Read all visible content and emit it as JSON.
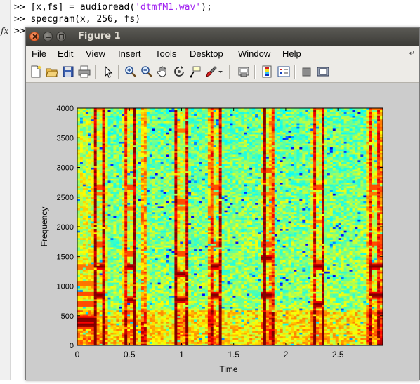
{
  "console": {
    "prompt": ">>",
    "line1": {
      "pre": " [x,fs] = audioread(",
      "str": "'dtmfM1.wav'",
      "post": ");"
    },
    "line2": " specgram(x, 256, fs)",
    "fx": "fx"
  },
  "window": {
    "title": "Figure 1"
  },
  "menu": [
    {
      "label": "File",
      "ul": "F",
      "rest": "ile"
    },
    {
      "label": "Edit",
      "ul": "E",
      "rest": "dit"
    },
    {
      "label": "View",
      "ul": "V",
      "rest": "iew"
    },
    {
      "label": "Insert",
      "ul": "I",
      "rest": "nsert"
    },
    {
      "label": "Tools",
      "ul": "T",
      "rest": "ools"
    },
    {
      "label": "Desktop",
      "ul": "D",
      "rest": "esktop"
    },
    {
      "label": "Window",
      "ul": "W",
      "rest": "indow"
    },
    {
      "label": "Help",
      "ul": "H",
      "rest": "elp"
    }
  ],
  "toolbar_icons": [
    "new-figure-icon",
    "open-file-icon",
    "save-icon",
    "print-icon",
    "select-arrow-icon",
    "zoom-in-icon",
    "zoom-out-icon",
    "pan-hand-icon",
    "rotate-3d-icon",
    "data-cursor-icon",
    "brush-icon",
    "link-plot-icon",
    "colorbar-icon",
    "legend-icon",
    "hide-plot-tools-icon",
    "show-plot-tools-icon"
  ],
  "chart_data": {
    "type": "heatmap",
    "xlabel": "Time",
    "ylabel": "Frequency",
    "xlim": [
      0,
      2.93
    ],
    "ylim": [
      0,
      4000
    ],
    "xticks": [
      0,
      0.5,
      1,
      1.5,
      2,
      2.5
    ],
    "xticklabels": [
      "0",
      "0.5",
      "1",
      "1.5",
      "2",
      "2.5"
    ],
    "yticks": [
      0,
      500,
      1000,
      1500,
      2000,
      2500,
      3000,
      3500,
      4000
    ],
    "yticklabels": [
      "0",
      "500",
      "1000",
      "1500",
      "2000",
      "2500",
      "3000",
      "3500",
      "4000"
    ],
    "colormap": "jet",
    "tones": [
      {
        "t0": 0.0,
        "t1": 0.17,
        "freqs": [
          350,
          440
        ]
      },
      {
        "t0": 0.17,
        "t1": 0.27,
        "freqs": [
          852,
          1336
        ]
      },
      {
        "t0": 0.47,
        "t1": 0.56,
        "freqs": [
          770,
          1336
        ]
      },
      {
        "t0": 0.93,
        "t1": 1.05,
        "freqs": [
          770,
          1209
        ]
      },
      {
        "t0": 1.27,
        "t1": 1.37,
        "freqs": [
          852,
          1336
        ]
      },
      {
        "t0": 1.77,
        "t1": 1.87,
        "freqs": [
          852,
          1477
        ]
      },
      {
        "t0": 2.27,
        "t1": 2.37,
        "freqs": [
          697,
          1336
        ]
      },
      {
        "t0": 2.8,
        "t1": 2.93,
        "freqs": [
          852,
          1336
        ]
      }
    ],
    "broadband_bursts": [
      0.17,
      0.26,
      0.46,
      0.55,
      0.64,
      0.95,
      1.05,
      1.28,
      1.37,
      1.8,
      1.87,
      2.27,
      2.36,
      2.8,
      2.9
    ]
  }
}
